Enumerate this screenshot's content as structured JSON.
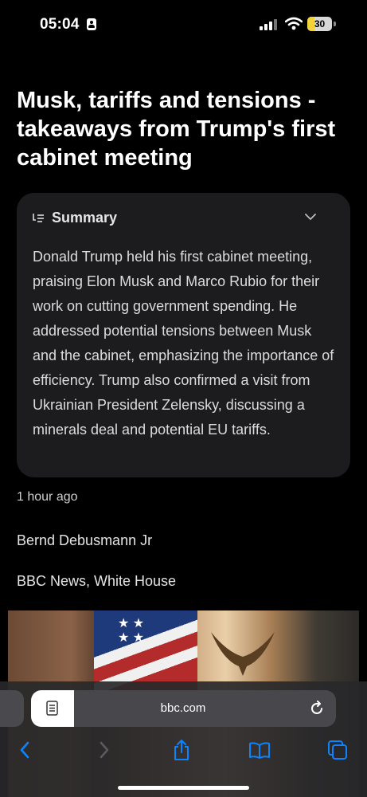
{
  "status_bar": {
    "time": "05:04",
    "battery_level": "30",
    "battery_percent": 30,
    "icons": [
      "person-badge-icon",
      "cellular-signal-icon",
      "wifi-icon",
      "battery-icon"
    ]
  },
  "article": {
    "headline": "Musk, tariffs and tensions - takeaways from Trump's first cabinet meeting",
    "summary": {
      "title": "Summary",
      "text": "Donald Trump held his first cabinet meeting, praising Elon Musk and Marco Rubio for their work on cutting government spending. He addressed potential tensions between Musk and the cabinet, emphasizing the importance of efficiency. Trump also confirmed a visit from Ukrainian President Zelensky, discussing a minerals deal and potential EU tariffs."
    },
    "timestamp": "1 hour ago",
    "author": "Bernd Debusmann Jr",
    "dateline": "BBC News, White House"
  },
  "browser": {
    "url": "bbc.com",
    "accent_color": "#0a84ff",
    "toolbar_icons": [
      "back-icon",
      "forward-icon",
      "share-icon",
      "bookmarks-icon",
      "tabs-icon"
    ]
  }
}
